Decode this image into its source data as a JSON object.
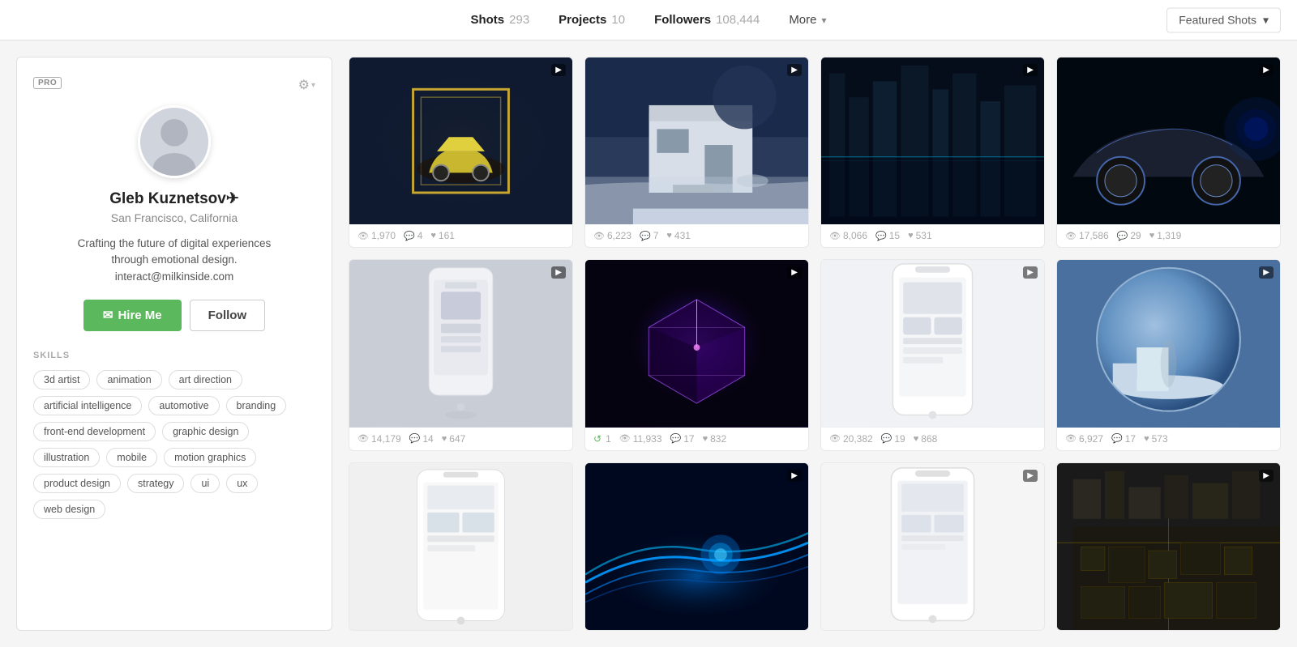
{
  "nav": {
    "shots_label": "Shots",
    "shots_count": "293",
    "projects_label": "Projects",
    "projects_count": "10",
    "followers_label": "Followers",
    "followers_count": "108,444",
    "more_label": "More",
    "featured_label": "Featured Shots"
  },
  "sidebar": {
    "pro_badge": "PRO",
    "username": "Gleb Kuznetsov✈",
    "location": "San Francisco, California",
    "bio": "Crafting the future of digital experiences\nthrough emotional design.\ninteract@milkinside.com",
    "hire_label": "Hire Me",
    "follow_label": "Follow",
    "skills_title": "SKILLS",
    "skills": [
      "3d artist",
      "animation",
      "art direction",
      "artificial intelligence",
      "automotive",
      "branding",
      "front-end development",
      "graphic design",
      "illustration",
      "mobile",
      "motion graphics",
      "product design",
      "strategy",
      "ui",
      "ux",
      "web design"
    ]
  },
  "shots": [
    {
      "id": 1,
      "views": "1,970",
      "comments": "4",
      "likes": "161",
      "has_video": true,
      "bg": "shot-1"
    },
    {
      "id": 2,
      "views": "6,223",
      "comments": "7",
      "likes": "431",
      "has_video": true,
      "bg": "shot-2"
    },
    {
      "id": 3,
      "views": "8,066",
      "comments": "15",
      "likes": "531",
      "has_video": true,
      "bg": "shot-3"
    },
    {
      "id": 4,
      "views": "17,586",
      "comments": "29",
      "likes": "1,319",
      "has_video": true,
      "bg": "shot-4"
    },
    {
      "id": 5,
      "views": "14,179",
      "comments": "14",
      "likes": "647",
      "has_video": true,
      "bg": "shot-5"
    },
    {
      "id": 6,
      "views": "11,933",
      "comments": "17",
      "likes": "832",
      "has_video": true,
      "bg": "shot-6",
      "reblog": "1"
    },
    {
      "id": 7,
      "views": "20,382",
      "comments": "19",
      "likes": "868",
      "has_video": true,
      "bg": "shot-7"
    },
    {
      "id": 8,
      "views": "6,927",
      "comments": "17",
      "likes": "573",
      "has_video": true,
      "bg": "shot-8"
    },
    {
      "id": 9,
      "views": "",
      "comments": "",
      "likes": "",
      "has_video": false,
      "bg": "shot-9"
    },
    {
      "id": 10,
      "views": "",
      "comments": "",
      "likes": "",
      "has_video": true,
      "bg": "shot-10"
    },
    {
      "id": 11,
      "views": "",
      "comments": "",
      "likes": "",
      "has_video": true,
      "bg": "shot-11"
    },
    {
      "id": 12,
      "views": "",
      "comments": "",
      "likes": "",
      "has_video": true,
      "bg": "shot-12"
    }
  ]
}
